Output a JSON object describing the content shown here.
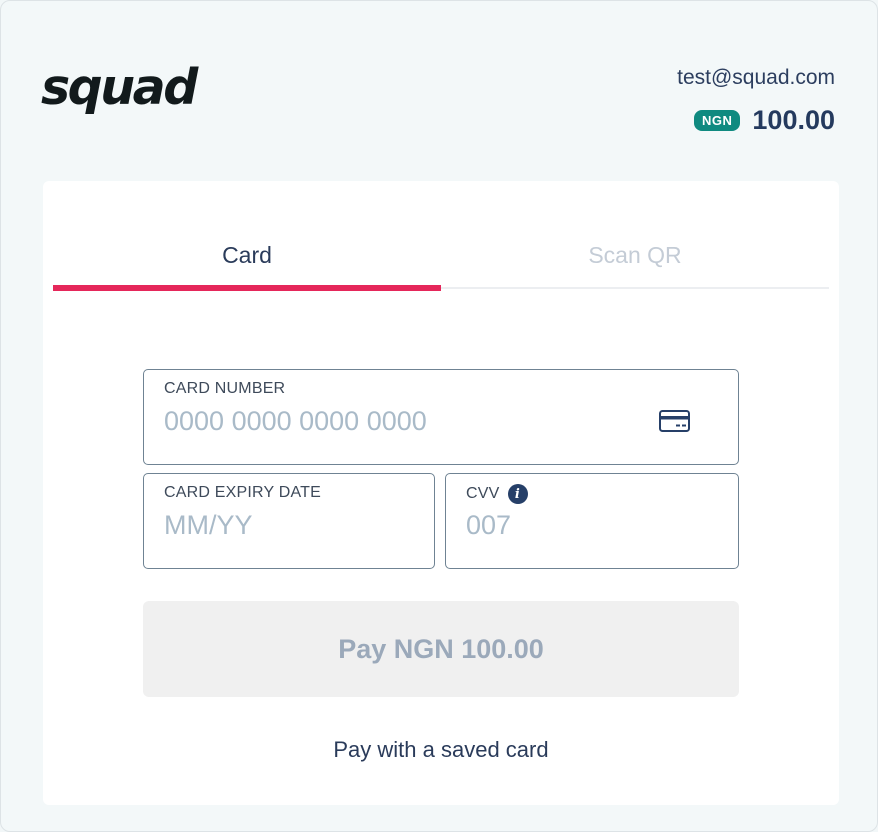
{
  "brand": {
    "logo_text": "squad"
  },
  "header": {
    "email": "test@squad.com",
    "currency": "NGN",
    "amount": "100.00"
  },
  "tabs": [
    {
      "label": "Card",
      "active": true
    },
    {
      "label": "Scan QR",
      "active": false
    }
  ],
  "form": {
    "card_number": {
      "label": "CARD NUMBER",
      "placeholder": "0000 0000 0000 0000",
      "value": "",
      "icon": "credit-card-icon"
    },
    "expiry": {
      "label": "CARD EXPIRY DATE",
      "placeholder": "MM/YY",
      "value": ""
    },
    "cvv": {
      "label": "CVV",
      "placeholder": "007",
      "value": "",
      "icon": "info-icon"
    }
  },
  "pay_button": {
    "label": "Pay NGN 100.00",
    "disabled": true
  },
  "saved_card_link": "Pay with a saved card",
  "colors": {
    "accent": "#e5275a",
    "badge": "#0f8a80",
    "text_primary": "#2a3b5a",
    "placeholder": "#a9bac8"
  }
}
